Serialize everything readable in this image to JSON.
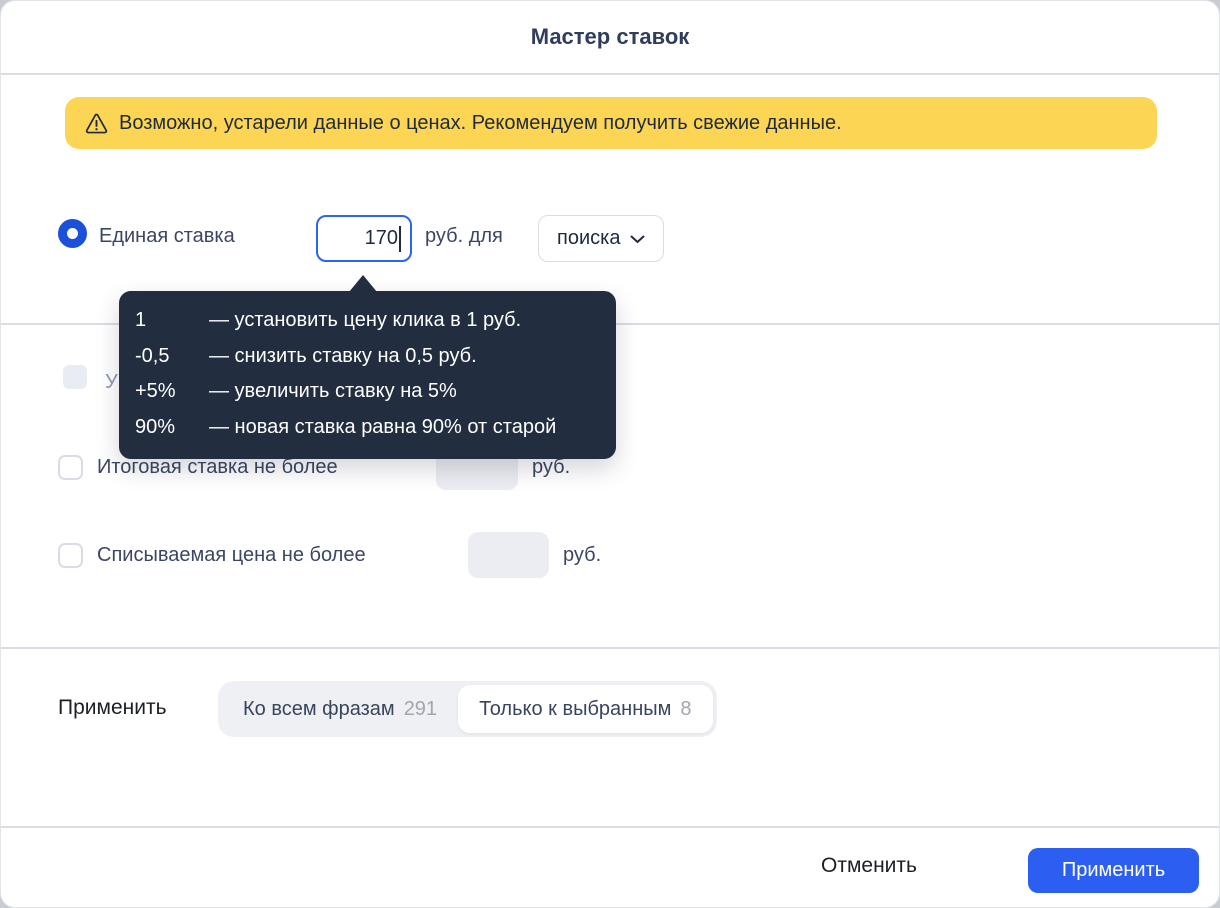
{
  "dialog": {
    "title": "Мастер ставок"
  },
  "warning": {
    "icon": "warning-triangle-icon",
    "text": "Возможно, устарели данные о ценах. Рекомендуем получить свежие данные."
  },
  "bid_row": {
    "radio_label": "Единая ставка",
    "bid_value": "170",
    "suffix_label": "руб. для",
    "target_select_value": "поиска"
  },
  "tooltip": {
    "rows": [
      {
        "term": "1",
        "description": "— установить цену клика в 1 руб."
      },
      {
        "term": "-0,5",
        "description": "— снизить ставку на 0,5 руб."
      },
      {
        "term": "+5%",
        "description": "— увеличить ставку на 5%"
      },
      {
        "term": "90%",
        "description": "— новая ставка равна 90% от старой"
      }
    ]
  },
  "options": {
    "hidden_row_partial_label": "У",
    "max_final_bid": {
      "label": "Итоговая ставка не более",
      "value": "",
      "suffix": "руб."
    },
    "max_charged_price": {
      "label": "Списываемая цена не более",
      "value": "",
      "suffix": "руб."
    }
  },
  "apply_scope": {
    "label": "Применить",
    "segments": [
      {
        "label": "Ко всем фразам",
        "count": "291"
      },
      {
        "label": "Только к выбранным",
        "count": "8"
      }
    ]
  },
  "footer": {
    "cancel_label": "Отменить",
    "apply_label": "Применить"
  },
  "colors": {
    "accent_blue": "#2c5ff1",
    "radio_blue": "#1b51da",
    "input_focus_border": "#2a65f6",
    "warning_bg": "#fbd553",
    "tooltip_bg": "#232d40",
    "divider": "#d9dde6",
    "text_navy": "#3a4663",
    "muted_count": "#a0a6b1"
  }
}
